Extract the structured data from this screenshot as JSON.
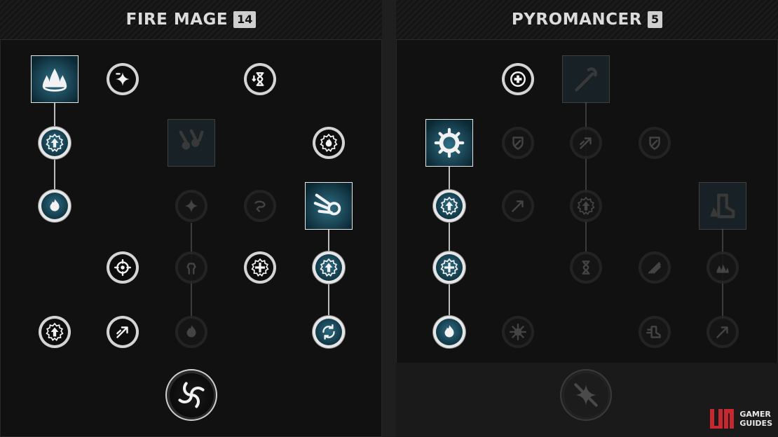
{
  "trees": [
    {
      "title": "FIRE MAGE",
      "level": "14",
      "nodes": [
        {
          "id": "fm_r0c0",
          "shape": "square",
          "state": "active",
          "icon": "fire-burst-icon"
        },
        {
          "id": "fm_r0c1",
          "shape": "circle",
          "state": "neutral",
          "icon": "spark-minus-icon"
        },
        {
          "id": "fm_r0c3",
          "shape": "circle",
          "state": "neutral",
          "icon": "hourglass-down-icon"
        },
        {
          "id": "fm_r1c0",
          "shape": "circle",
          "state": "active",
          "icon": "arrow-up-badge-icon"
        },
        {
          "id": "fm_r1c2",
          "shape": "square",
          "state": "dim",
          "icon": "meteor-shower-icon"
        },
        {
          "id": "fm_r1c4",
          "shape": "circle",
          "state": "neutral",
          "icon": "flame-badge-icon"
        },
        {
          "id": "fm_r2c0",
          "shape": "circle",
          "state": "active",
          "icon": "flame-burst-icon"
        },
        {
          "id": "fm_r2c2",
          "shape": "circle",
          "state": "dim",
          "icon": "spark-icon"
        },
        {
          "id": "fm_r2c3",
          "shape": "circle",
          "state": "dim",
          "icon": "swirl-arrow-icon"
        },
        {
          "id": "fm_r2c4",
          "shape": "square",
          "state": "active",
          "icon": "fire-comet-icon"
        },
        {
          "id": "fm_r3c1",
          "shape": "circle",
          "state": "neutral",
          "icon": "crosshair-icon"
        },
        {
          "id": "fm_r3c2",
          "shape": "circle",
          "state": "dim",
          "icon": "fist-burst-icon"
        },
        {
          "id": "fm_r3c3",
          "shape": "circle",
          "state": "neutral",
          "icon": "plus-badge-icon"
        },
        {
          "id": "fm_r3c4",
          "shape": "circle",
          "state": "active",
          "icon": "arrow-up-badge-icon"
        },
        {
          "id": "fm_r4c0",
          "shape": "circle",
          "state": "neutral",
          "icon": "arrow-up-badge-icon"
        },
        {
          "id": "fm_r4c1",
          "shape": "circle",
          "state": "neutral",
          "icon": "fire-arrow-icon"
        },
        {
          "id": "fm_r4c2",
          "shape": "circle",
          "state": "dim",
          "icon": "skull-burst-icon"
        },
        {
          "id": "fm_r4c4",
          "shape": "circle",
          "state": "active",
          "icon": "cycle-arrows-icon"
        },
        {
          "id": "fm_ult",
          "shape": "big",
          "state": "neutral",
          "icon": "vortex-icon"
        }
      ]
    },
    {
      "title": "PYROMANCER",
      "level": "5",
      "nodes": [
        {
          "id": "py_r0c1",
          "shape": "circle",
          "state": "neutral",
          "icon": "plus-shield-icon"
        },
        {
          "id": "py_r0c2",
          "shape": "square",
          "state": "dim",
          "icon": "fire-staff-icon"
        },
        {
          "id": "py_r1c0",
          "shape": "square",
          "state": "active",
          "icon": "fire-ring-icon"
        },
        {
          "id": "py_r1c1",
          "shape": "circle",
          "state": "dim",
          "icon": "leaf-shield-icon"
        },
        {
          "id": "py_r1c2",
          "shape": "circle",
          "state": "dim",
          "icon": "fire-arrow-icon"
        },
        {
          "id": "py_r1c3",
          "shape": "circle",
          "state": "dim",
          "icon": "sun-leaf-icon"
        },
        {
          "id": "py_r2c0",
          "shape": "circle",
          "state": "active",
          "icon": "arrow-up-badge-icon"
        },
        {
          "id": "py_r2c1",
          "shape": "circle",
          "state": "dim",
          "icon": "arrow-diagonal-icon"
        },
        {
          "id": "py_r2c2",
          "shape": "circle",
          "state": "dim",
          "icon": "arrow-up-badge-icon"
        },
        {
          "id": "py_r2c4",
          "shape": "square",
          "state": "dim",
          "icon": "flame-boot-icon"
        },
        {
          "id": "py_r3c0",
          "shape": "circle",
          "state": "active",
          "icon": "plus-badge-icon"
        },
        {
          "id": "py_r3c2",
          "shape": "circle",
          "state": "dim",
          "icon": "hourglass-icon"
        },
        {
          "id": "py_r3c3",
          "shape": "circle",
          "state": "dim",
          "icon": "claw-icon"
        },
        {
          "id": "py_r3c4",
          "shape": "circle",
          "state": "dim",
          "icon": "flame-wall-icon"
        },
        {
          "id": "py_r4c0",
          "shape": "circle",
          "state": "active",
          "icon": "twin-flame-icon"
        },
        {
          "id": "py_r4c1",
          "shape": "circle",
          "state": "dim",
          "icon": "spiked-orb-icon"
        },
        {
          "id": "py_r4c3",
          "shape": "circle",
          "state": "dim",
          "icon": "dash-boot-icon"
        },
        {
          "id": "py_r4c4",
          "shape": "circle",
          "state": "dim",
          "icon": "arrow-diagonal-icon"
        },
        {
          "id": "py_ult",
          "shape": "big",
          "state": "dim",
          "icon": "slash-spark-icon"
        }
      ]
    }
  ],
  "watermark": {
    "line1": "GAMER",
    "line2": "GUIDES",
    "color": "#c8282f"
  }
}
